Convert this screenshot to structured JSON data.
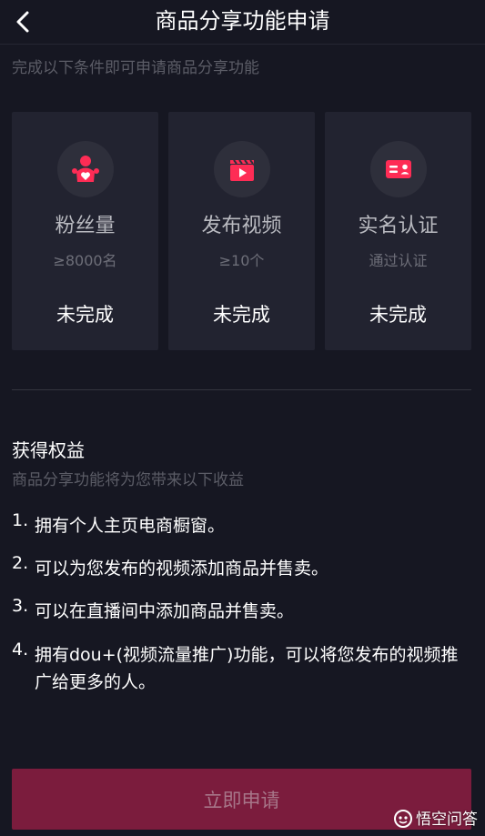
{
  "header": {
    "title": "商品分享功能申请"
  },
  "subtitle": "完成以下条件即可申请商品分享功能",
  "conditions": [
    {
      "icon": "fans-icon",
      "title": "粉丝量",
      "requirement": "≥8000名",
      "status": "未完成"
    },
    {
      "icon": "video-clapper-icon",
      "title": "发布视频",
      "requirement": "≥10个",
      "status": "未完成"
    },
    {
      "icon": "id-card-icon",
      "title": "实名认证",
      "requirement": "通过认证",
      "status": "未完成"
    }
  ],
  "benefits": {
    "title": "获得权益",
    "subtitle": "商品分享功能将为您带来以下收益",
    "items": [
      {
        "num": "1.",
        "text": "拥有个人主页电商橱窗。"
      },
      {
        "num": "2.",
        "text": "可以为您发布的视频添加商品并售卖。"
      },
      {
        "num": "3.",
        "text": "可以在直播间中添加商品并售卖。"
      },
      {
        "num": "4.",
        "text": "拥有dou+(视频流量推广)功能，可以将您发布的视频推广给更多的人。"
      }
    ]
  },
  "apply_button": "立即申请",
  "watermark": "悟空问答",
  "colors": {
    "background": "#161722",
    "card": "#222330",
    "accent": "#fe2c55",
    "button": "#7b1c3d"
  }
}
